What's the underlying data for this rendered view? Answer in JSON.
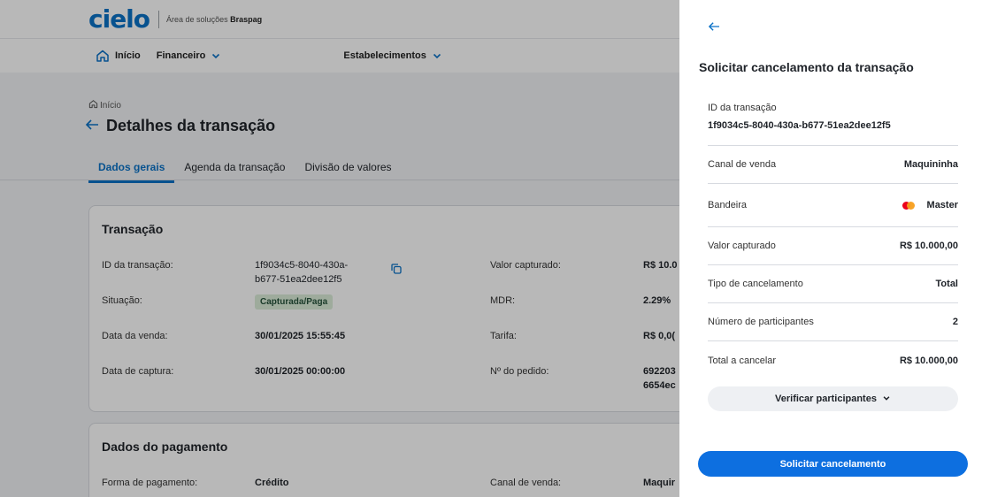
{
  "header": {
    "logo": "cielo",
    "subtitle_prefix": "Área de soluções",
    "subtitle_brand": "Braspag"
  },
  "nav": {
    "home": "Início",
    "finance": "Financeiro",
    "establishments": "Estabelecimentos"
  },
  "page": {
    "breadcrumb": "Início",
    "title": "Detalhes da transação",
    "tabs": [
      "Dados gerais",
      "Agenda da transação",
      "Divisão de valores"
    ]
  },
  "transaction_card": {
    "title": "Transação",
    "id_label": "ID da transação:",
    "id_value_line1": "1f9034c5-8040-430a-",
    "id_value_line2": "b677-51ea2dee12f5",
    "status_label": "Situação:",
    "status_value": "Capturada/Paga",
    "sale_date_label": "Data da venda:",
    "sale_date_value": "30/01/2025 15:55:45",
    "capture_date_label": "Data de captura:",
    "capture_date_value": "30/01/2025 00:00:00",
    "captured_value_label": "Valor capturado:",
    "captured_value_value": "R$ 10.0",
    "mdr_label": "MDR:",
    "mdr_value": "2.29%",
    "fee_label": "Tarifa:",
    "fee_value": "R$ 0,0(",
    "order_label": "Nº do pedido:",
    "order_value_line1": "692203",
    "order_value_line2": "6654ec"
  },
  "payment_card": {
    "title": "Dados do pagamento",
    "method_label": "Forma de pagamento:",
    "method_value": "Crédito",
    "channel_label": "Canal de venda:",
    "channel_value": "Maquir"
  },
  "drawer": {
    "title": "Solicitar cancelamento da transação",
    "id_label": "ID da transação",
    "id_value": "1f9034c5-8040-430a-b677-51ea2dee12f5",
    "rows": [
      {
        "label": "Canal de venda",
        "value": "Maquininha"
      },
      {
        "label": "Bandeira",
        "value": "Master"
      },
      {
        "label": "Valor capturado",
        "value": "R$ 10.000,00"
      },
      {
        "label": "Tipo de cancelamento",
        "value": "Total"
      },
      {
        "label": "Número de participantes",
        "value": "2"
      },
      {
        "label": "Total a cancelar",
        "value": "R$ 10.000,00"
      }
    ],
    "verify_button": "Verificar participantes",
    "submit_button": "Solicitar cancelamento"
  },
  "colors": {
    "brand_blue": "#0b72c7",
    "primary_button": "#0d6fe0",
    "status_badge_bg": "#dbeed9"
  },
  "icons": {
    "back": "arrow-left-icon",
    "home": "home-icon",
    "chevron": "chevron-down-icon",
    "copy": "copy-icon",
    "card_brand": "mastercard-icon"
  }
}
